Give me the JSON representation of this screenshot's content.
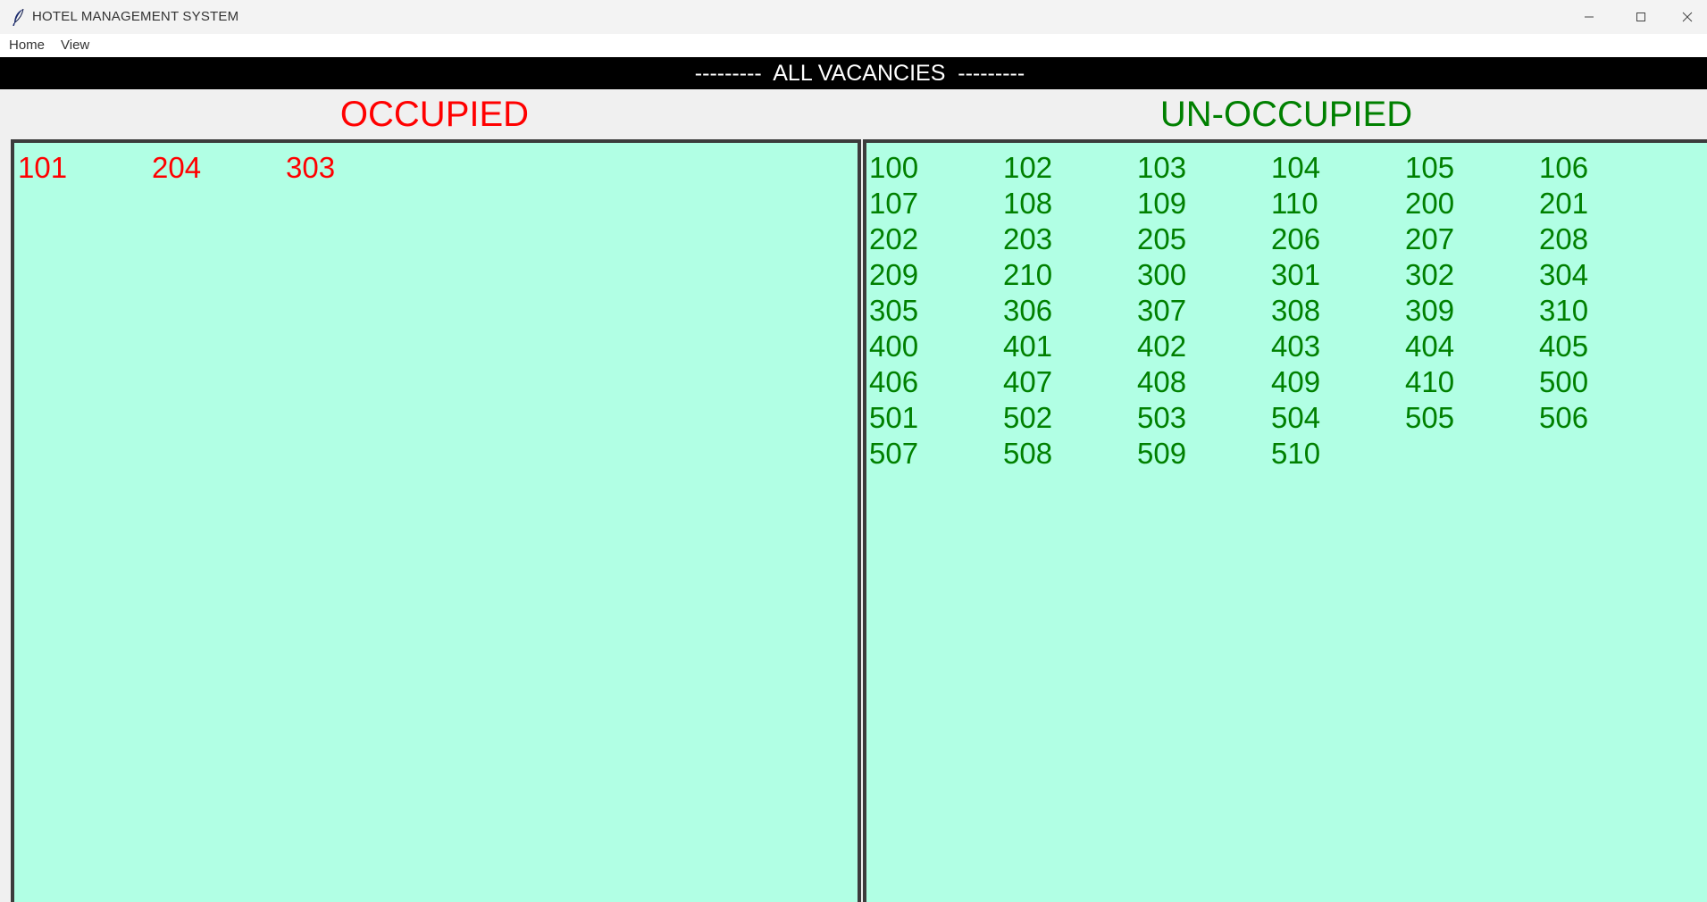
{
  "window": {
    "title": "HOTEL MANAGEMENT SYSTEM",
    "app_icon": "feather-icon",
    "controls": [
      "minimize-icon",
      "maximize-icon",
      "close-icon"
    ]
  },
  "menu": {
    "home": "Home",
    "view": "View"
  },
  "banner": {
    "text": "---------  ALL VACANCIES  ---------"
  },
  "occupied": {
    "heading": "OCCUPIED",
    "color": "#ff0000",
    "rooms": [
      "101",
      "204",
      "303"
    ]
  },
  "unoccupied": {
    "heading": "UN-OCCUPIED",
    "color": "#008000",
    "rooms": [
      "100",
      "102",
      "103",
      "104",
      "105",
      "106",
      "107",
      "108",
      "109",
      "110",
      "200",
      "201",
      "202",
      "203",
      "205",
      "206",
      "207",
      "208",
      "209",
      "210",
      "300",
      "301",
      "302",
      "304",
      "305",
      "306",
      "307",
      "308",
      "309",
      "310",
      "400",
      "401",
      "402",
      "403",
      "404",
      "405",
      "406",
      "407",
      "408",
      "409",
      "410",
      "500",
      "501",
      "502",
      "503",
      "504",
      "505",
      "506",
      "507",
      "508",
      "509",
      "510"
    ]
  },
  "colors": {
    "panel_background": "#b1ffe4",
    "banner_background": "#000000"
  }
}
